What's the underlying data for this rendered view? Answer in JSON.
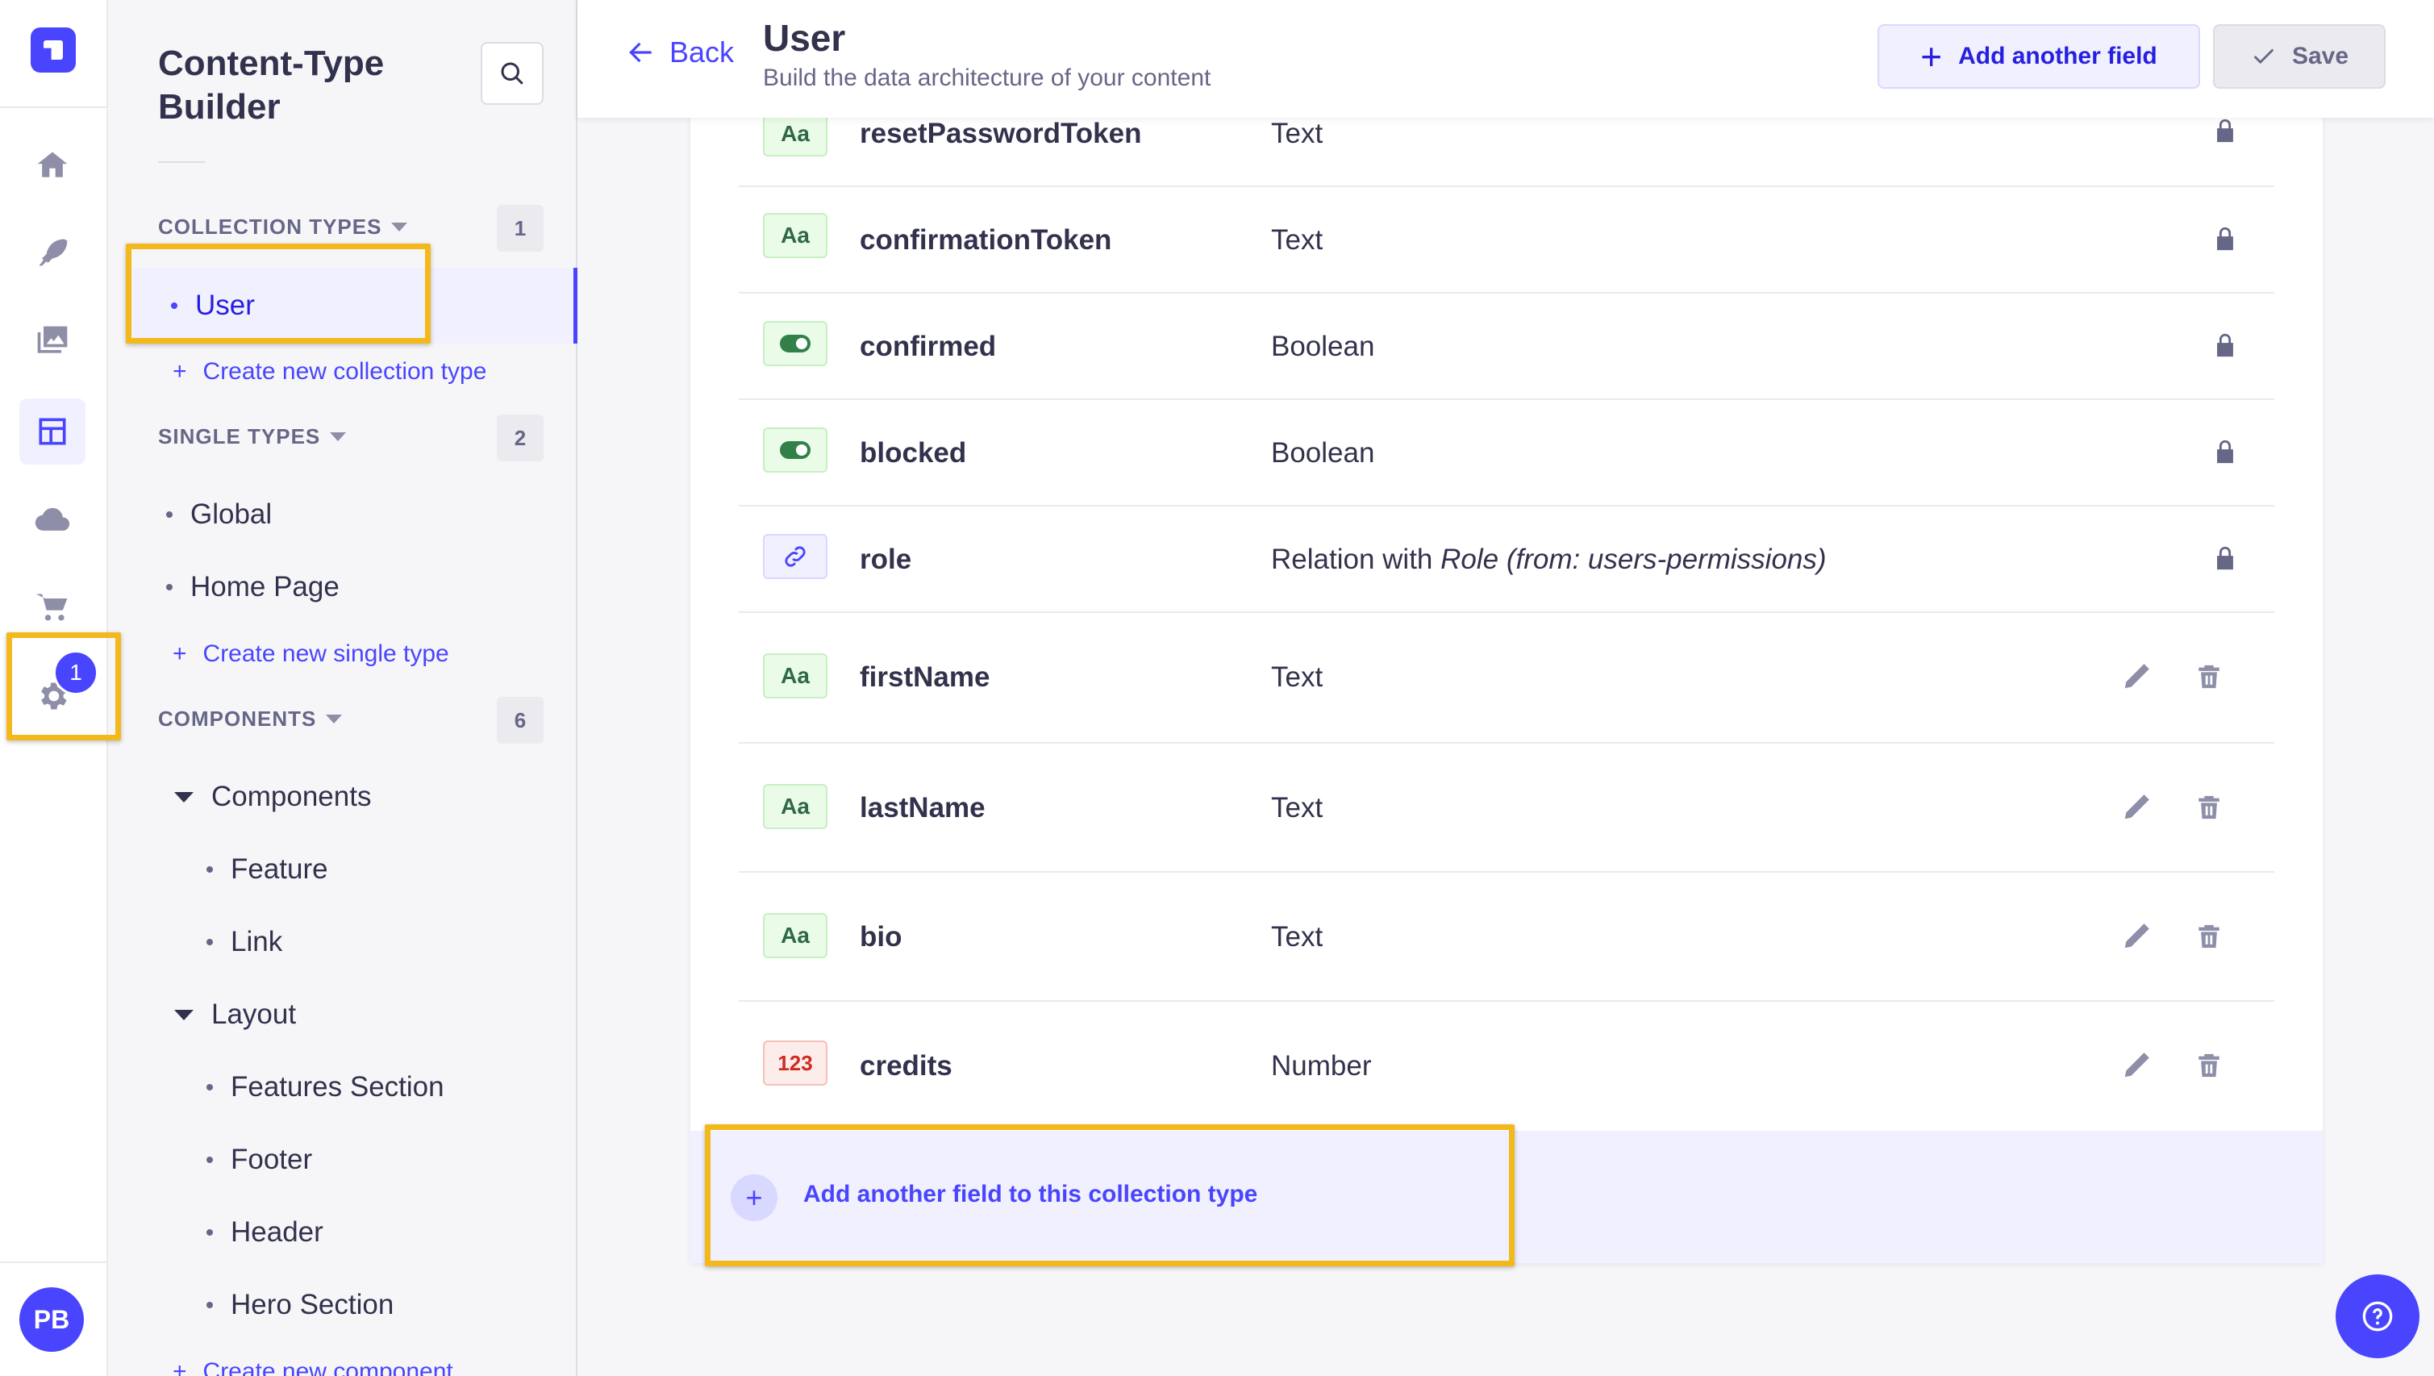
{
  "nav": {
    "avatar_initials": "PB",
    "settings_badge": "1"
  },
  "subnav": {
    "title": "Content-Type Builder",
    "collection_types": {
      "title": "COLLECTION TYPES",
      "count": "1",
      "items": [
        "User"
      ],
      "create": "Create new collection type"
    },
    "single_types": {
      "title": "SINGLE TYPES",
      "count": "2",
      "items": [
        "Global",
        "Home Page"
      ],
      "create": "Create new single type"
    },
    "components": {
      "title": "COMPONENTS",
      "count": "6",
      "groups": [
        {
          "label": "Components",
          "items": [
            "Feature",
            "Link"
          ]
        },
        {
          "label": "Layout",
          "items": [
            "Features Section",
            "Footer",
            "Header",
            "Hero Section"
          ]
        }
      ],
      "create": "Create new component"
    }
  },
  "header": {
    "back": "Back",
    "title": "User",
    "subtitle": "Build the data architecture of your content",
    "add_button": "Add another field",
    "save_button": "Save"
  },
  "fields": [
    {
      "icon": "Aa",
      "name": "resetPasswordToken",
      "type": "Text"
    },
    {
      "icon": "Aa",
      "name": "confirmationToken",
      "type": "Text"
    },
    {
      "icon": "",
      "name": "confirmed",
      "type": "Boolean"
    },
    {
      "icon": "",
      "name": "blocked",
      "type": "Boolean"
    },
    {
      "icon": "",
      "name": "role",
      "type_prefix": "Relation with ",
      "type_italic": "Role (from: users-permissions)"
    },
    {
      "icon": "Aa",
      "name": "firstName",
      "type": "Text"
    },
    {
      "icon": "Aa",
      "name": "lastName",
      "type": "Text"
    },
    {
      "icon": "Aa",
      "name": "bio",
      "type": "Text"
    },
    {
      "icon": "123",
      "name": "credits",
      "type": "Number"
    }
  ],
  "add_field_bar": {
    "label": "Add another field to this collection type"
  },
  "colors": {
    "primary": "#4945ff",
    "highlight": "#f2b81c"
  }
}
